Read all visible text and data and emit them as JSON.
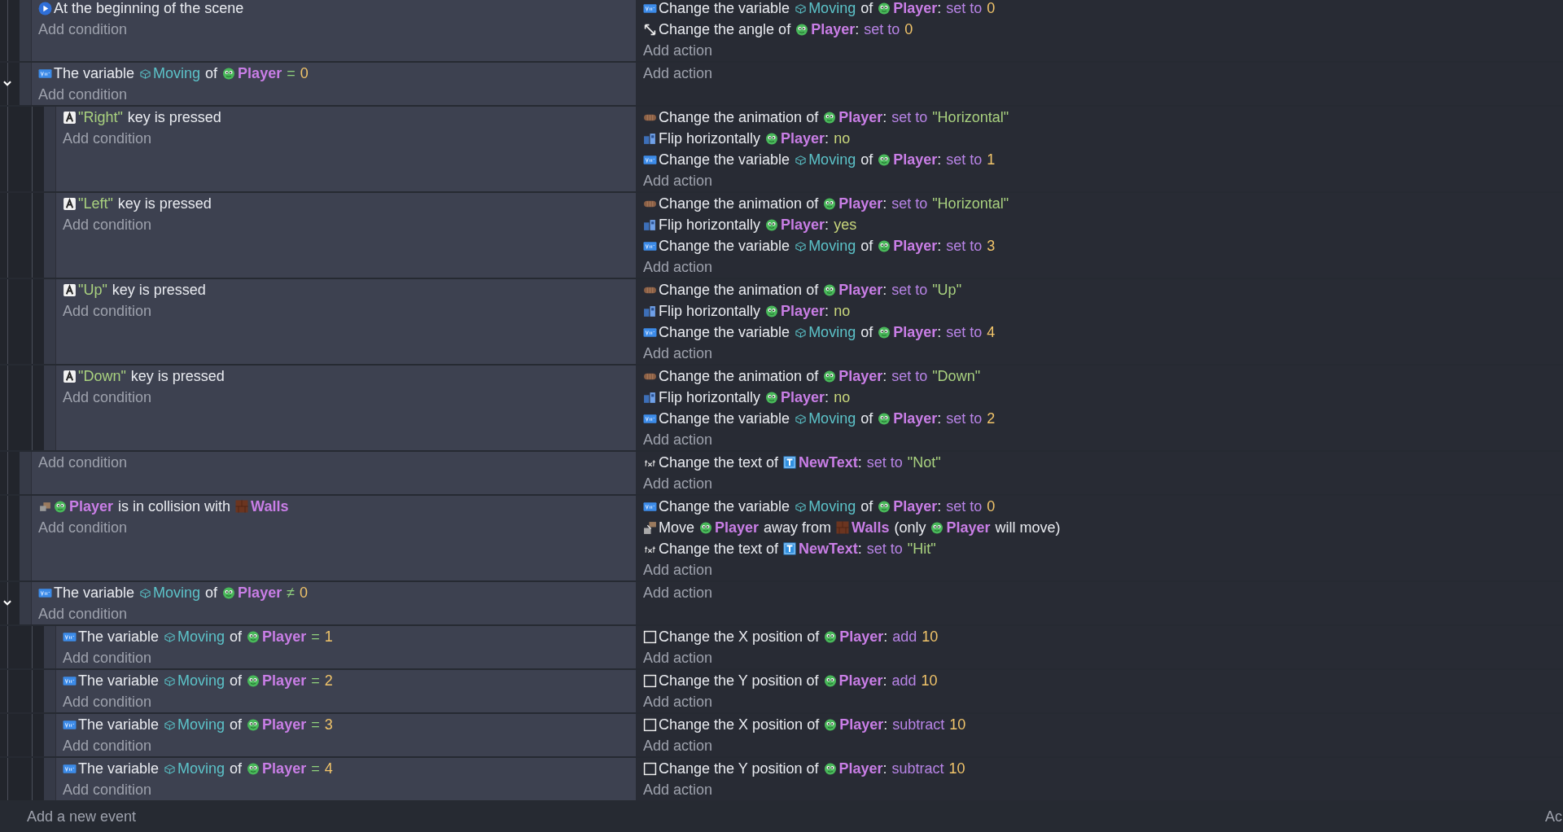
{
  "events": [
    {
      "conditions": [
        {
          "kind": "scene-start",
          "parts": [
            {
              "kind": "text",
              "text": "At the beginning of the scene"
            }
          ]
        }
      ],
      "add_condition": "Add condition",
      "actions": [
        {
          "kind": "variable",
          "parts": [
            {
              "kind": "text",
              "text": "Change the variable"
            },
            {
              "kind": "variable",
              "text": "Moving"
            },
            {
              "kind": "text",
              "text": "of"
            },
            {
              "kind": "sprite-object",
              "text": "Player"
            },
            {
              "kind": "colon",
              "text": ":"
            },
            {
              "kind": "keyword",
              "text": "set to"
            },
            {
              "kind": "number",
              "text": "0"
            }
          ]
        },
        {
          "kind": "angle",
          "parts": [
            {
              "kind": "text",
              "text": "Change the angle of"
            },
            {
              "kind": "sprite-object",
              "text": "Player"
            },
            {
              "kind": "colon",
              "text": ":"
            },
            {
              "kind": "keyword",
              "text": "set to"
            },
            {
              "kind": "number",
              "text": "0"
            }
          ]
        }
      ],
      "add_action": "Add action"
    },
    {
      "expanded": true,
      "conditions": [
        {
          "kind": "variable",
          "parts": [
            {
              "kind": "text",
              "text": "The variable"
            },
            {
              "kind": "variable",
              "text": "Moving"
            },
            {
              "kind": "text",
              "text": "of"
            },
            {
              "kind": "sprite-object",
              "text": "Player"
            },
            {
              "kind": "op",
              "text": "="
            },
            {
              "kind": "number",
              "text": "0"
            }
          ]
        }
      ],
      "add_condition": "Add condition",
      "add_action": "Add action",
      "children": [
        {
          "conditions": [
            {
              "kind": "key",
              "parts": [
                {
                  "kind": "string",
                  "text": "\"Right\""
                },
                {
                  "kind": "text",
                  "text": "key is pressed"
                }
              ]
            }
          ],
          "add_condition": "Add condition",
          "actions": [
            {
              "kind": "animation",
              "parts": [
                {
                  "kind": "text",
                  "text": "Change the animation of"
                },
                {
                  "kind": "sprite-object",
                  "text": "Player"
                },
                {
                  "kind": "colon",
                  "text": ":"
                },
                {
                  "kind": "keyword",
                  "text": "set to"
                },
                {
                  "kind": "string",
                  "text": "\"Horizontal\""
                }
              ]
            },
            {
              "kind": "flip",
              "parts": [
                {
                  "kind": "text",
                  "text": "Flip horizontally"
                },
                {
                  "kind": "sprite-object",
                  "text": "Player"
                },
                {
                  "kind": "colon",
                  "text": ":"
                },
                {
                  "kind": "bool",
                  "text": "no"
                }
              ]
            },
            {
              "kind": "variable",
              "parts": [
                {
                  "kind": "text",
                  "text": "Change the variable"
                },
                {
                  "kind": "variable",
                  "text": "Moving"
                },
                {
                  "kind": "text",
                  "text": "of"
                },
                {
                  "kind": "sprite-object",
                  "text": "Player"
                },
                {
                  "kind": "colon",
                  "text": ":"
                },
                {
                  "kind": "keyword",
                  "text": "set to"
                },
                {
                  "kind": "number",
                  "text": "1"
                }
              ]
            }
          ],
          "add_action": "Add action"
        },
        {
          "conditions": [
            {
              "kind": "key",
              "parts": [
                {
                  "kind": "string",
                  "text": "\"Left\""
                },
                {
                  "kind": "text",
                  "text": "key is pressed"
                }
              ]
            }
          ],
          "add_condition": "Add condition",
          "actions": [
            {
              "kind": "animation",
              "parts": [
                {
                  "kind": "text",
                  "text": "Change the animation of"
                },
                {
                  "kind": "sprite-object",
                  "text": "Player"
                },
                {
                  "kind": "colon",
                  "text": ":"
                },
                {
                  "kind": "keyword",
                  "text": "set to"
                },
                {
                  "kind": "string",
                  "text": "\"Horizontal\""
                }
              ]
            },
            {
              "kind": "flip",
              "parts": [
                {
                  "kind": "text",
                  "text": "Flip horizontally"
                },
                {
                  "kind": "sprite-object",
                  "text": "Player"
                },
                {
                  "kind": "colon",
                  "text": ":"
                },
                {
                  "kind": "bool",
                  "text": "yes"
                }
              ]
            },
            {
              "kind": "variable",
              "parts": [
                {
                  "kind": "text",
                  "text": "Change the variable"
                },
                {
                  "kind": "variable",
                  "text": "Moving"
                },
                {
                  "kind": "text",
                  "text": "of"
                },
                {
                  "kind": "sprite-object",
                  "text": "Player"
                },
                {
                  "kind": "colon",
                  "text": ":"
                },
                {
                  "kind": "keyword",
                  "text": "set to"
                },
                {
                  "kind": "number",
                  "text": "3"
                }
              ]
            }
          ],
          "add_action": "Add action"
        },
        {
          "conditions": [
            {
              "kind": "key",
              "parts": [
                {
                  "kind": "string",
                  "text": "\"Up\""
                },
                {
                  "kind": "text",
                  "text": "key is pressed"
                }
              ]
            }
          ],
          "add_condition": "Add condition",
          "actions": [
            {
              "kind": "animation",
              "parts": [
                {
                  "kind": "text",
                  "text": "Change the animation of"
                },
                {
                  "kind": "sprite-object",
                  "text": "Player"
                },
                {
                  "kind": "colon",
                  "text": ":"
                },
                {
                  "kind": "keyword",
                  "text": "set to"
                },
                {
                  "kind": "string",
                  "text": "\"Up\""
                }
              ]
            },
            {
              "kind": "flip",
              "parts": [
                {
                  "kind": "text",
                  "text": "Flip horizontally"
                },
                {
                  "kind": "sprite-object",
                  "text": "Player"
                },
                {
                  "kind": "colon",
                  "text": ":"
                },
                {
                  "kind": "bool",
                  "text": "no"
                }
              ]
            },
            {
              "kind": "variable",
              "parts": [
                {
                  "kind": "text",
                  "text": "Change the variable"
                },
                {
                  "kind": "variable",
                  "text": "Moving"
                },
                {
                  "kind": "text",
                  "text": "of"
                },
                {
                  "kind": "sprite-object",
                  "text": "Player"
                },
                {
                  "kind": "colon",
                  "text": ":"
                },
                {
                  "kind": "keyword",
                  "text": "set to"
                },
                {
                  "kind": "number",
                  "text": "4"
                }
              ]
            }
          ],
          "add_action": "Add action"
        },
        {
          "conditions": [
            {
              "kind": "key",
              "parts": [
                {
                  "kind": "string",
                  "text": "\"Down\""
                },
                {
                  "kind": "text",
                  "text": "key is pressed"
                }
              ]
            }
          ],
          "add_condition": "Add condition",
          "actions": [
            {
              "kind": "animation",
              "parts": [
                {
                  "kind": "text",
                  "text": "Change the animation of"
                },
                {
                  "kind": "sprite-object",
                  "text": "Player"
                },
                {
                  "kind": "colon",
                  "text": ":"
                },
                {
                  "kind": "keyword",
                  "text": "set to"
                },
                {
                  "kind": "string",
                  "text": "\"Down\""
                }
              ]
            },
            {
              "kind": "flip",
              "parts": [
                {
                  "kind": "text",
                  "text": "Flip horizontally"
                },
                {
                  "kind": "sprite-object",
                  "text": "Player"
                },
                {
                  "kind": "colon",
                  "text": ":"
                },
                {
                  "kind": "bool",
                  "text": "no"
                }
              ]
            },
            {
              "kind": "variable",
              "parts": [
                {
                  "kind": "text",
                  "text": "Change the variable"
                },
                {
                  "kind": "variable",
                  "text": "Moving"
                },
                {
                  "kind": "text",
                  "text": "of"
                },
                {
                  "kind": "sprite-object",
                  "text": "Player"
                },
                {
                  "kind": "colon",
                  "text": ":"
                },
                {
                  "kind": "keyword",
                  "text": "set to"
                },
                {
                  "kind": "number",
                  "text": "2"
                }
              ]
            }
          ],
          "add_action": "Add action"
        }
      ]
    },
    {
      "add_condition": "Add condition",
      "actions": [
        {
          "kind": "text",
          "parts": [
            {
              "kind": "text",
              "text": "Change the text of"
            },
            {
              "kind": "text-object",
              "text": "NewText"
            },
            {
              "kind": "colon",
              "text": ":"
            },
            {
              "kind": "keyword",
              "text": "set to"
            },
            {
              "kind": "string",
              "text": "\"Not\""
            }
          ]
        }
      ],
      "add_action": "Add action"
    },
    {
      "conditions": [
        {
          "kind": "collision",
          "parts": [
            {
              "kind": "sprite-object",
              "text": "Player"
            },
            {
              "kind": "text",
              "text": "is in collision with"
            },
            {
              "kind": "tile-object",
              "text": "Walls"
            }
          ]
        }
      ],
      "add_condition": "Add condition",
      "actions": [
        {
          "kind": "variable",
          "parts": [
            {
              "kind": "text",
              "text": "Change the variable"
            },
            {
              "kind": "variable",
              "text": "Moving"
            },
            {
              "kind": "text",
              "text": "of"
            },
            {
              "kind": "sprite-object",
              "text": "Player"
            },
            {
              "kind": "colon",
              "text": ":"
            },
            {
              "kind": "keyword",
              "text": "set to"
            },
            {
              "kind": "number",
              "text": "0"
            }
          ]
        },
        {
          "kind": "separate",
          "parts": [
            {
              "kind": "text",
              "text": "Move"
            },
            {
              "kind": "sprite-object",
              "text": "Player"
            },
            {
              "kind": "text",
              "text": "away from"
            },
            {
              "kind": "tile-object",
              "text": "Walls"
            },
            {
              "kind": "text",
              "text": "(only"
            },
            {
              "kind": "sprite-object",
              "text": "Player"
            },
            {
              "kind": "text",
              "text": "will move)"
            }
          ]
        },
        {
          "kind": "text",
          "parts": [
            {
              "kind": "text",
              "text": "Change the text of"
            },
            {
              "kind": "text-object",
              "text": "NewText"
            },
            {
              "kind": "colon",
              "text": ":"
            },
            {
              "kind": "keyword",
              "text": "set to"
            },
            {
              "kind": "string",
              "text": "\"Hit\""
            }
          ]
        }
      ],
      "add_action": "Add action"
    },
    {
      "expanded": true,
      "conditions": [
        {
          "kind": "variable",
          "parts": [
            {
              "kind": "text",
              "text": "The variable"
            },
            {
              "kind": "variable",
              "text": "Moving"
            },
            {
              "kind": "text",
              "text": "of"
            },
            {
              "kind": "sprite-object",
              "text": "Player"
            },
            {
              "kind": "op",
              "text": "≠"
            },
            {
              "kind": "number",
              "text": "0"
            }
          ]
        }
      ],
      "add_condition": "Add condition",
      "add_action": "Add action",
      "children": [
        {
          "conditions": [
            {
              "kind": "variable",
              "parts": [
                {
                  "kind": "text",
                  "text": "The variable"
                },
                {
                  "kind": "variable",
                  "text": "Moving"
                },
                {
                  "kind": "text",
                  "text": "of"
                },
                {
                  "kind": "sprite-object",
                  "text": "Player"
                },
                {
                  "kind": "op",
                  "text": "="
                },
                {
                  "kind": "number",
                  "text": "1"
                }
              ]
            }
          ],
          "add_condition": "Add condition",
          "actions": [
            {
              "kind": "position",
              "parts": [
                {
                  "kind": "text",
                  "text": "Change the X position of"
                },
                {
                  "kind": "sprite-object",
                  "text": "Player"
                },
                {
                  "kind": "colon",
                  "text": ":"
                },
                {
                  "kind": "keyword",
                  "text": "add"
                },
                {
                  "kind": "number",
                  "text": "10"
                }
              ]
            }
          ],
          "add_action": "Add action"
        },
        {
          "conditions": [
            {
              "kind": "variable",
              "parts": [
                {
                  "kind": "text",
                  "text": "The variable"
                },
                {
                  "kind": "variable",
                  "text": "Moving"
                },
                {
                  "kind": "text",
                  "text": "of"
                },
                {
                  "kind": "sprite-object",
                  "text": "Player"
                },
                {
                  "kind": "op",
                  "text": "="
                },
                {
                  "kind": "number",
                  "text": "2"
                }
              ]
            }
          ],
          "add_condition": "Add condition",
          "actions": [
            {
              "kind": "position",
              "parts": [
                {
                  "kind": "text",
                  "text": "Change the Y position of"
                },
                {
                  "kind": "sprite-object",
                  "text": "Player"
                },
                {
                  "kind": "colon",
                  "text": ":"
                },
                {
                  "kind": "keyword",
                  "text": "add"
                },
                {
                  "kind": "number",
                  "text": "10"
                }
              ]
            }
          ],
          "add_action": "Add action"
        },
        {
          "conditions": [
            {
              "kind": "variable",
              "parts": [
                {
                  "kind": "text",
                  "text": "The variable"
                },
                {
                  "kind": "variable",
                  "text": "Moving"
                },
                {
                  "kind": "text",
                  "text": "of"
                },
                {
                  "kind": "sprite-object",
                  "text": "Player"
                },
                {
                  "kind": "op",
                  "text": "="
                },
                {
                  "kind": "number",
                  "text": "3"
                }
              ]
            }
          ],
          "add_condition": "Add condition",
          "actions": [
            {
              "kind": "position",
              "parts": [
                {
                  "kind": "text",
                  "text": "Change the X position of"
                },
                {
                  "kind": "sprite-object",
                  "text": "Player"
                },
                {
                  "kind": "colon",
                  "text": ":"
                },
                {
                  "kind": "keyword",
                  "text": "subtract"
                },
                {
                  "kind": "number",
                  "text": "10"
                }
              ]
            }
          ],
          "add_action": "Add action"
        },
        {
          "conditions": [
            {
              "kind": "variable",
              "parts": [
                {
                  "kind": "text",
                  "text": "The variable"
                },
                {
                  "kind": "variable",
                  "text": "Moving"
                },
                {
                  "kind": "text",
                  "text": "of"
                },
                {
                  "kind": "sprite-object",
                  "text": "Player"
                },
                {
                  "kind": "op",
                  "text": "="
                },
                {
                  "kind": "number",
                  "text": "4"
                }
              ]
            }
          ],
          "add_condition": "Add condition",
          "actions": [
            {
              "kind": "position",
              "parts": [
                {
                  "kind": "text",
                  "text": "Change the Y position of"
                },
                {
                  "kind": "sprite-object",
                  "text": "Player"
                },
                {
                  "kind": "colon",
                  "text": ":"
                },
                {
                  "kind": "keyword",
                  "text": "subtract"
                },
                {
                  "kind": "number",
                  "text": "10"
                }
              ]
            }
          ],
          "add_action": "Add action"
        }
      ]
    }
  ],
  "footer": {
    "add_event": "Add a new event",
    "edge_text": "Ac"
  }
}
